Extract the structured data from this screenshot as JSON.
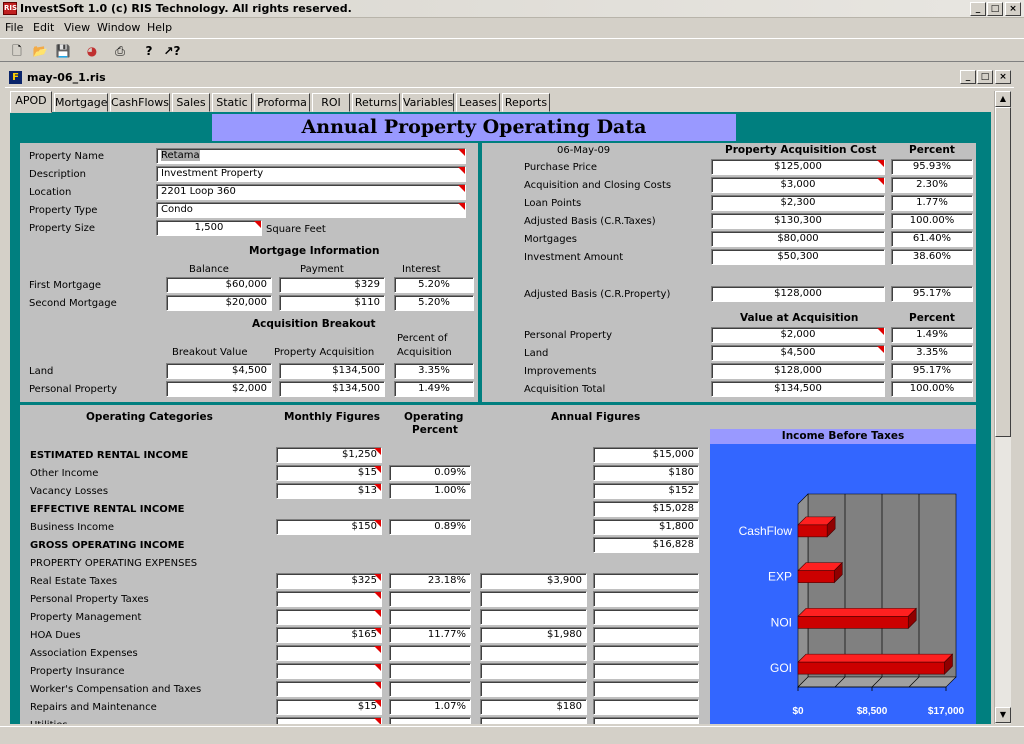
{
  "app": {
    "title": "InvestSoft 1.0 (c) RIS Technology. All rights reserved.",
    "icon_text": "RIS",
    "window_controls": [
      "_",
      "□",
      "×"
    ]
  },
  "menu": [
    "File",
    "Edit",
    "View",
    "Window",
    "Help"
  ],
  "toolbar_icons": [
    "new-icon",
    "open-folder-icon",
    "save-icon",
    "palette-icon",
    "print-icon",
    "help-icon",
    "context-help-icon"
  ],
  "toolbar_glyphs": [
    "🗋",
    "📂",
    "💾",
    "◕",
    "⎙",
    "?",
    "↗?"
  ],
  "document": {
    "title": "may-06_1.ris",
    "icon_text": "F"
  },
  "tabs": [
    {
      "label": "APOD",
      "active": true
    },
    {
      "label": "Mortgage"
    },
    {
      "label": "CashFlows"
    },
    {
      "label": "Sales"
    },
    {
      "label": "Static"
    },
    {
      "label": "Proforma"
    },
    {
      "label": "ROI"
    },
    {
      "label": "Returns"
    },
    {
      "label": "Variables"
    },
    {
      "label": "Leases"
    },
    {
      "label": "Reports"
    }
  ],
  "page_title": "Annual Property Operating Data",
  "property": {
    "name_label": "Property Name",
    "name": "Retama",
    "desc_label": "Description",
    "desc": "Investment Property",
    "loc_label": "Location",
    "loc": "2201 Loop 360",
    "type_label": "Property Type",
    "type": "Condo",
    "size_label": "Property Size",
    "size": "1,500",
    "size_unit": "Square Feet"
  },
  "mortgage": {
    "title": "Mortgage Information",
    "col_balance": "Balance",
    "col_payment": "Payment",
    "col_interest": "Interest",
    "first_label": "First Mortgage",
    "first_balance": "$60,000",
    "first_payment": "$329",
    "first_interest": "5.20%",
    "second_label": "Second Mortgage",
    "second_balance": "$20,000",
    "second_payment": "$110",
    "second_interest": "5.20%"
  },
  "breakout": {
    "title": "Acquisition Breakout",
    "col_value": "Breakout Value",
    "col_acq": "Property Acquisition",
    "col_pct_1": "Percent of",
    "col_pct_2": "Acquisition",
    "land_label": "Land",
    "land_value": "$4,500",
    "land_acq": "$134,500",
    "land_pct": "3.35%",
    "pp_label": "Personal Property",
    "pp_value": "$2,000",
    "pp_acq": "$134,500",
    "pp_pct": "1.49%"
  },
  "acquisition": {
    "date": "06-May-09",
    "col_cost": "Property Acquisition Cost",
    "col_pct": "Percent",
    "rows": [
      {
        "label": "Purchase Price",
        "value": "$125,000",
        "pct": "95.93%"
      },
      {
        "label": "Acquisition and Closing Costs",
        "value": "$3,000",
        "pct": "2.30%"
      },
      {
        "label": "Loan Points",
        "value": "$2,300",
        "pct": "1.77%"
      },
      {
        "label": "Adjusted Basis (C.R.Taxes)",
        "value": "$130,300",
        "pct": "100.00%"
      },
      {
        "label": "Mortgages",
        "value": "$80,000",
        "pct": "61.40%"
      },
      {
        "label": "Investment Amount",
        "value": "$50,300",
        "pct": "38.60%"
      }
    ],
    "adj_label": "Adjusted Basis (C.R.Property)",
    "adj_value": "$128,000",
    "adj_pct": "95.17%",
    "col_value2": "Value at Acquisition",
    "col_pct2": "Percent",
    "rows2": [
      {
        "label": "Personal Property",
        "value": "$2,000",
        "pct": "1.49%"
      },
      {
        "label": "Land",
        "value": "$4,500",
        "pct": "3.35%"
      },
      {
        "label": "Improvements",
        "value": "$128,000",
        "pct": "95.17%"
      },
      {
        "label": "Acquisition Total",
        "value": "$134,500",
        "pct": "100.00%"
      }
    ]
  },
  "operating": {
    "col_cat": "Operating Categories",
    "col_monthly": "Monthly Figures",
    "col_pct_1": "Operating",
    "col_pct_2": "Percent",
    "col_annual": "Annual Figures",
    "rows": [
      {
        "label": "ESTIMATED RENTAL INCOME",
        "bold": true,
        "monthly": "$1,250",
        "pct": null,
        "annual1": null,
        "annual2": "$15,000"
      },
      {
        "label": "Other Income",
        "monthly": "$15",
        "pct": "0.09%",
        "annual1": null,
        "annual2": "$180"
      },
      {
        "label": "Vacancy Losses",
        "monthly": "$13",
        "pct": "1.00%",
        "annual1": null,
        "annual2": "$152"
      },
      {
        "label": "EFFECTIVE RENTAL INCOME",
        "bold": true,
        "monthly": null,
        "pct": null,
        "annual1": null,
        "annual2": "$15,028"
      },
      {
        "label": "Business Income",
        "monthly": "$150",
        "pct": "0.89%",
        "annual1": null,
        "annual2": "$1,800"
      },
      {
        "label": "GROSS OPERATING INCOME",
        "bold": true,
        "monthly": null,
        "pct": null,
        "annual1": null,
        "annual2": "$16,828"
      },
      {
        "label": "PROPERTY OPERATING EXPENSES",
        "monthly": null,
        "pct": null,
        "annual1": null,
        "annual2": null
      },
      {
        "label": "Real Estate Taxes",
        "monthly": "$325",
        "pct": "23.18%",
        "annual1": "$3,900",
        "annual2": ""
      },
      {
        "label": "Personal Property Taxes",
        "monthly": "",
        "pct": "",
        "annual1": "",
        "annual2": ""
      },
      {
        "label": "Property Management",
        "monthly": "",
        "pct": "",
        "annual1": "",
        "annual2": ""
      },
      {
        "label": "HOA Dues",
        "monthly": "$165",
        "pct": "11.77%",
        "annual1": "$1,980",
        "annual2": ""
      },
      {
        "label": "Association Expenses",
        "monthly": "",
        "pct": "",
        "annual1": "",
        "annual2": ""
      },
      {
        "label": "Property Insurance",
        "monthly": "",
        "pct": "",
        "annual1": "",
        "annual2": ""
      },
      {
        "label": "Worker's Compensation and Taxes",
        "monthly": "",
        "pct": "",
        "annual1": "",
        "annual2": ""
      },
      {
        "label": "Repairs and Maintenance",
        "monthly": "$15",
        "pct": "1.07%",
        "annual1": "$180",
        "annual2": ""
      },
      {
        "label": "Utilities",
        "monthly": "",
        "pct": "",
        "annual1": "",
        "annual2": ""
      }
    ]
  },
  "chart_data": {
    "type": "bar",
    "orientation": "horizontal",
    "title": "Income Before Taxes",
    "categories": [
      "CashFlow",
      "EXP",
      "NOI",
      "GOI"
    ],
    "values": [
      3348,
      4166,
      12662,
      16828
    ],
    "xlim": [
      0,
      17000
    ],
    "xticks": [
      "$0",
      "$8,500",
      "$17,000"
    ],
    "grid": true,
    "bar_color": "#cc0000",
    "background_color": "#3366ff"
  }
}
